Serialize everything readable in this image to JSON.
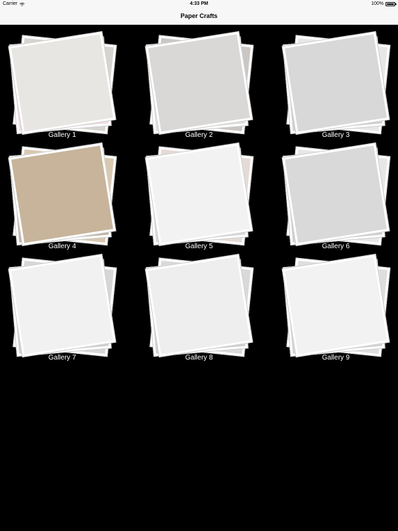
{
  "status_bar": {
    "carrier": "Carrier",
    "time": "4:33 PM",
    "battery_percent": "100%",
    "wifi_icon": "wifi-icon",
    "battery_icon": "battery-icon"
  },
  "nav": {
    "title": "Paper Crafts"
  },
  "galleries": [
    {
      "label": "Gallery 1",
      "front": "#e8e6e2",
      "back1": "#d7d4d0",
      "back2": "#f1dde4"
    },
    {
      "label": "Gallery 2",
      "front": "#dad8d6",
      "back1": "#c9c6c3",
      "back2": "#e2e0de"
    },
    {
      "label": "Gallery 3",
      "front": "#d8d8d8",
      "back1": "#e7e7e7",
      "back2": "#cfcfcf"
    },
    {
      "label": "Gallery 4",
      "front": "#c7b49b",
      "back1": "#d8c8b0",
      "back2": "#bfb5a6"
    },
    {
      "label": "Gallery 5",
      "front": "#f2f2f2",
      "back1": "#e6dad6",
      "back2": "#d8d8d8"
    },
    {
      "label": "Gallery 6",
      "front": "#d9d9d9",
      "back1": "#e7e7e7",
      "back2": "#cfcfcf"
    },
    {
      "label": "Gallery 7",
      "front": "#f1f1f1",
      "back1": "#d6d6d6",
      "back2": "#cfcfcf"
    },
    {
      "label": "Gallery 8",
      "front": "#eeeeee",
      "back1": "#d9d9d9",
      "back2": "#cfcfcf"
    },
    {
      "label": "Gallery 9",
      "front": "#f2f2f2",
      "back1": "#dedede",
      "back2": "#d3d3d3"
    }
  ]
}
